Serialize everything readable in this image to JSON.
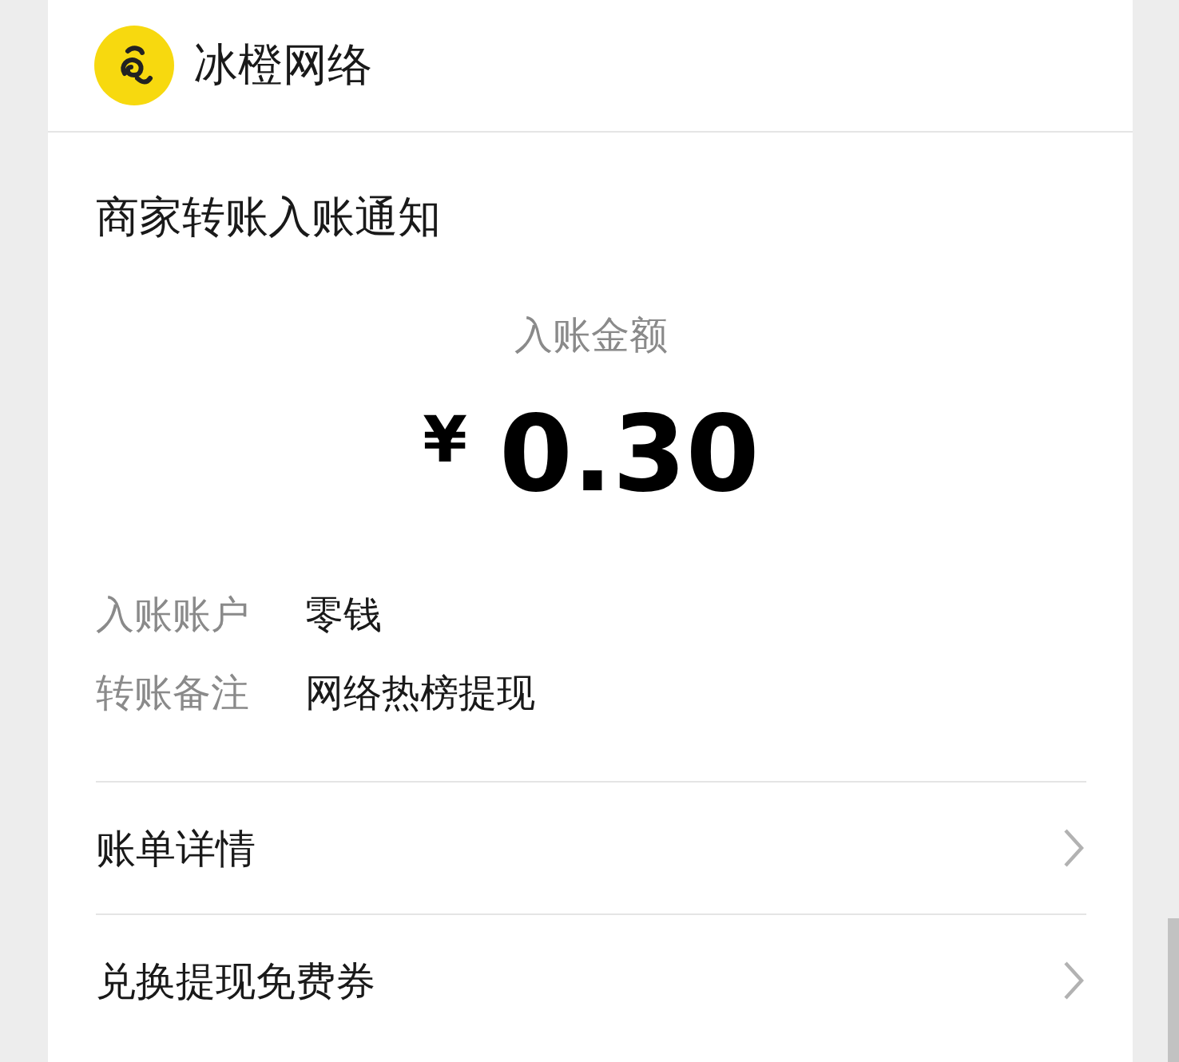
{
  "header": {
    "name": "冰橙网络"
  },
  "notice": {
    "title": "商家转账入账通知",
    "amount_label": "入账金额",
    "currency": "¥",
    "amount": "0.30",
    "details": [
      {
        "label": "入账账户",
        "value": "零钱"
      },
      {
        "label": "转账备注",
        "value": "网络热榜提现"
      }
    ]
  },
  "links": [
    {
      "label": "账单详情"
    },
    {
      "label": "兑换提现免费券"
    }
  ]
}
